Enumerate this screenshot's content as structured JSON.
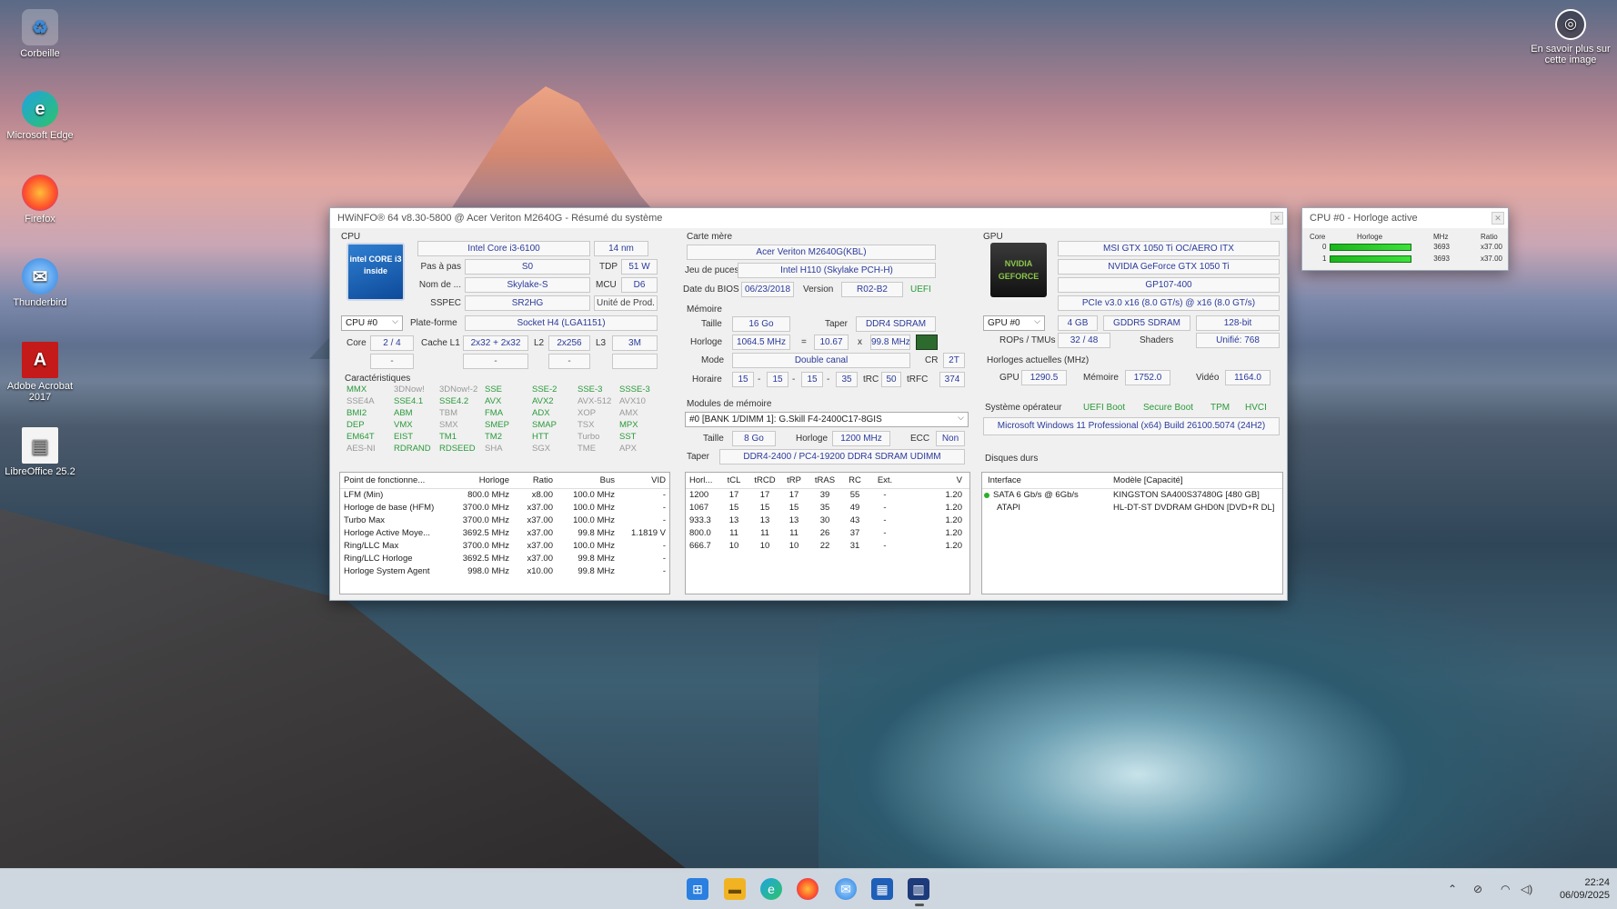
{
  "desktop": {
    "icons": [
      {
        "label": "Corbeille"
      },
      {
        "label": "Microsoft Edge"
      },
      {
        "label": "Firefox"
      },
      {
        "label": "Thunderbird"
      },
      {
        "label": "Adobe Acrobat 2017"
      },
      {
        "label": "LibreOffice 25.2"
      }
    ],
    "learn_more": "En savoir plus sur cette image"
  },
  "main_window": {
    "title": "HWiNFO® 64 v8.30-5800 @ Acer Veriton M2640G - Résumé du système",
    "cpu": {
      "section": "CPU",
      "logo_text": "intel CORE i3 inside",
      "name": "Intel Core i3-6100",
      "process": "14 nm",
      "stepping_label": "Pas à pas",
      "stepping": "S0",
      "tdp_label": "TDP",
      "tdp": "51 W",
      "codename_label": "Nom de ...",
      "codename": "Skylake-S",
      "mcu_label": "MCU",
      "mcu": "D6",
      "sspec_label": "SSPEC",
      "sspec": "SR2HG",
      "prod_unit": "Unité de Prod.",
      "cpu_select": "CPU #0",
      "platform_label": "Plate-forme",
      "platform": "Socket H4 (LGA1151)",
      "core_label": "Core",
      "cores": "2 / 4",
      "l1_label": "Cache L1",
      "l1": "2x32 + 2x32",
      "l2_label": "L2",
      "l2": "2x256",
      "l3_label": "L3",
      "l3": "3M",
      "dash1": "-",
      "dash2": "-",
      "dash3": "-",
      "features_label": "Caractéristiques",
      "features": [
        {
          "t": "MMX",
          "on": true
        },
        {
          "t": "3DNow!",
          "on": false
        },
        {
          "t": "3DNow!-2",
          "on": false
        },
        {
          "t": "SSE",
          "on": true
        },
        {
          "t": "SSE-2",
          "on": true
        },
        {
          "t": "SSE-3",
          "on": true
        },
        {
          "t": "SSSE-3",
          "on": true
        },
        {
          "t": "SSE4A",
          "on": false
        },
        {
          "t": "SSE4.1",
          "on": true
        },
        {
          "t": "SSE4.2",
          "on": true
        },
        {
          "t": "AVX",
          "on": true
        },
        {
          "t": "AVX2",
          "on": true
        },
        {
          "t": "AVX-512",
          "on": false
        },
        {
          "t": "AVX10",
          "on": false
        },
        {
          "t": "BMI2",
          "on": true
        },
        {
          "t": "ABM",
          "on": true
        },
        {
          "t": "TBM",
          "on": false
        },
        {
          "t": "FMA",
          "on": true
        },
        {
          "t": "ADX",
          "on": true
        },
        {
          "t": "XOP",
          "on": false
        },
        {
          "t": "AMX",
          "on": false
        },
        {
          "t": "DEP",
          "on": true
        },
        {
          "t": "VMX",
          "on": true
        },
        {
          "t": "SMX",
          "on": false
        },
        {
          "t": "SMEP",
          "on": true
        },
        {
          "t": "SMAP",
          "on": true
        },
        {
          "t": "TSX",
          "on": false
        },
        {
          "t": "MPX",
          "on": true
        },
        {
          "t": "EM64T",
          "on": true
        },
        {
          "t": "EIST",
          "on": true
        },
        {
          "t": "TM1",
          "on": true
        },
        {
          "t": "TM2",
          "on": true
        },
        {
          "t": "HTT",
          "on": true
        },
        {
          "t": "Turbo",
          "on": false
        },
        {
          "t": "SST",
          "on": true
        },
        {
          "t": "AES-NI",
          "on": false
        },
        {
          "t": "RDRAND",
          "on": true
        },
        {
          "t": "RDSEED",
          "on": true
        },
        {
          "t": "SHA",
          "on": false
        },
        {
          "t": "SGX",
          "on": false
        },
        {
          "t": "TME",
          "on": false
        },
        {
          "t": "APX",
          "on": false
        }
      ],
      "op_table": {
        "headers": [
          "Point de fonctionne...",
          "Horloge",
          "Ratio",
          "Bus",
          "VID"
        ],
        "rows": [
          [
            "LFM (Min)",
            "800.0 MHz",
            "x8.00",
            "100.0 MHz",
            "-"
          ],
          [
            "Horloge de base (HFM)",
            "3700.0 MHz",
            "x37.00",
            "100.0 MHz",
            "-"
          ],
          [
            "Turbo Max",
            "3700.0 MHz",
            "x37.00",
            "100.0 MHz",
            "-"
          ],
          [
            "Horloge Active Moye...",
            "3692.5 MHz",
            "x37.00",
            "99.8 MHz",
            "1.1819 V"
          ],
          [
            "Ring/LLC Max",
            "3700.0 MHz",
            "x37.00",
            "100.0 MHz",
            "-"
          ],
          [
            "Ring/LLC Horloge",
            "3692.5 MHz",
            "x37.00",
            "99.8 MHz",
            "-"
          ],
          [
            "Horloge System Agent",
            "998.0 MHz",
            "x10.00",
            "99.8 MHz",
            "-"
          ]
        ]
      }
    },
    "motherboard": {
      "section": "Carte mère",
      "name": "Acer Veriton M2640G(KBL)",
      "chipset_label": "Jeu de puces",
      "chipset": "Intel H110 (Skylake PCH-H)",
      "bios_date_label": "Date du BIOS",
      "bios_date": "06/23/2018",
      "version_label": "Version",
      "version": "R02-B2",
      "uefi": "UEFI"
    },
    "memory": {
      "section": "Mémoire",
      "size_label": "Taille",
      "size": "16 Go",
      "type_label": "Taper",
      "type": "DDR4 SDRAM",
      "clock_label": "Horloge",
      "clock": "1064.5 MHz",
      "eq": "=",
      "mult": "10.67",
      "x": "x",
      "bus": "99.8 MHz",
      "mode_label": "Mode",
      "mode": "Double canal",
      "cr_label": "CR",
      "cr": "2T",
      "timing_label": "Horaire",
      "t1": "15",
      "t2": "15",
      "t3": "15",
      "t4": "35",
      "trc_label": "tRC",
      "trc": "50",
      "trfc_label": "tRFC",
      "trfc": "374",
      "dash": "-"
    },
    "modules": {
      "section": "Modules de mémoire",
      "selected": "#0 [BANK 1/DIMM 1]: G.Skill F4-2400C17-8GIS",
      "size_label": "Taille",
      "size": "8 Go",
      "clock_label": "Horloge",
      "clock": "1200 MHz",
      "ecc_label": "ECC",
      "ecc": "Non",
      "type_label": "Taper",
      "type": "DDR4-2400 / PC4-19200 DDR4 SDRAM UDIMM",
      "timing_table": {
        "headers": [
          "Horl...",
          "tCL",
          "tRCD",
          "tRP",
          "tRAS",
          "RC",
          "Ext.",
          "V"
        ],
        "rows": [
          [
            "1200",
            "17",
            "17",
            "17",
            "39",
            "55",
            "-",
            "1.20"
          ],
          [
            "1067",
            "15",
            "15",
            "15",
            "35",
            "49",
            "-",
            "1.20"
          ],
          [
            "933.3",
            "13",
            "13",
            "13",
            "30",
            "43",
            "-",
            "1.20"
          ],
          [
            "800.0",
            "11",
            "11",
            "11",
            "26",
            "37",
            "-",
            "1.20"
          ],
          [
            "666.7",
            "10",
            "10",
            "10",
            "22",
            "31",
            "-",
            "1.20"
          ]
        ]
      }
    },
    "gpu": {
      "section": "GPU",
      "logo_text": "NVIDIA GEFORCE",
      "card": "MSI GTX 1050 Ti OC/AERO ITX",
      "name": "NVIDIA GeForce GTX 1050 Ti",
      "chip": "GP107-400",
      "pcie": "PCIe v3.0 x16 (8.0 GT/s) @ x16 (8.0 GT/s)",
      "gpu_select": "GPU #0",
      "vram": "4 GB",
      "vram_type": "GDDR5 SDRAM",
      "bus_width": "128-bit",
      "rops_label": "ROPs / TMUs",
      "rops": "32 / 48",
      "shaders_label": "Shaders",
      "shaders": "Unifié: 768",
      "clocks_label": "Horloges actuelles (MHz)",
      "gpu_clk_label": "GPU",
      "gpu_clk": "1290.5",
      "mem_clk_label": "Mémoire",
      "mem_clk": "1752.0",
      "video_clk_label": "Vidéo",
      "video_clk": "1164.0"
    },
    "os": {
      "label": "Système opérateur",
      "uefi_boot": "UEFI Boot",
      "secure_boot": "Secure Boot",
      "tpm": "TPM",
      "hvci": "HVCI",
      "name": "Microsoft Windows 11 Professional (x64) Build 26100.5074 (24H2)"
    },
    "disks": {
      "section": "Disques durs",
      "headers": [
        "Interface",
        "Modèle [Capacité]"
      ],
      "rows": [
        [
          "SATA 6 Gb/s @ 6Gb/s",
          "KINGSTON SA400S37480G [480 GB]"
        ],
        [
          "ATAPI",
          "HL-DT-ST DVDRAM GHD0N [DVD+R DL]"
        ]
      ]
    }
  },
  "clock_window": {
    "title": "CPU #0 - Horloge active",
    "headers": [
      "Core",
      "Horloge",
      "MHz",
      "Ratio"
    ],
    "rows": [
      {
        "core": "0",
        "mhz": "3693",
        "ratio": "x37.00",
        "fill": 1.0
      },
      {
        "core": "1",
        "mhz": "3693",
        "ratio": "x37.00",
        "fill": 1.0
      }
    ]
  },
  "taskbar": {
    "time": "22:24",
    "date": "06/09/2025"
  }
}
